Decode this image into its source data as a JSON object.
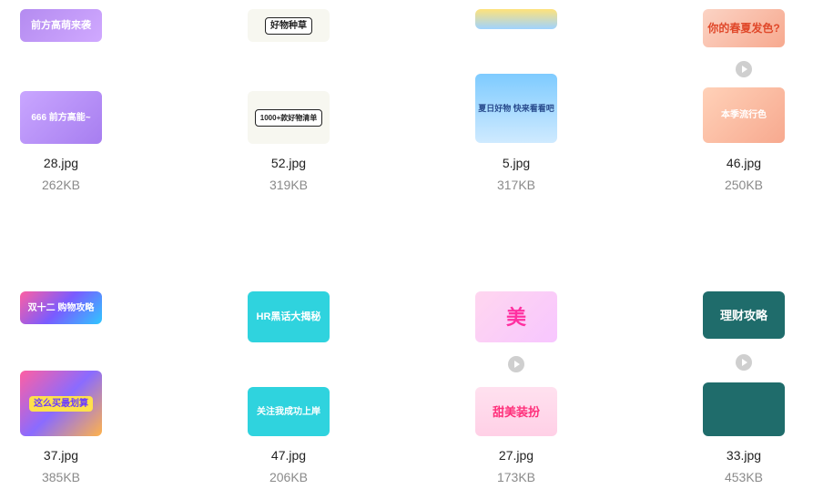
{
  "files": [
    {
      "name": "28.jpg",
      "size": "262KB",
      "top_text": "前方高萌来袭",
      "bottom_text": "666 前方高能~"
    },
    {
      "name": "52.jpg",
      "size": "319KB",
      "top_text": "好物种草",
      "bottom_text": "1000+款好物清单"
    },
    {
      "name": "5.jpg",
      "size": "317KB",
      "top_text": "",
      "bottom_text": "夏日好物 快来看看吧"
    },
    {
      "name": "46.jpg",
      "size": "250KB",
      "top_text": "你的春夏发色?",
      "bottom_text": "本季流行色"
    },
    {
      "name": "37.jpg",
      "size": "385KB",
      "top_text": "双十二 购物攻略",
      "bottom_text": "这么买最划算"
    },
    {
      "name": "47.jpg",
      "size": "206KB",
      "top_text": "HR黑话大揭秘",
      "bottom_text": "关注我成功上岸"
    },
    {
      "name": "27.jpg",
      "size": "173KB",
      "top_text": "美",
      "bottom_text": "甜美装扮"
    },
    {
      "name": "33.jpg",
      "size": "453KB",
      "top_text": "理财攻略",
      "bottom_text": ""
    }
  ]
}
